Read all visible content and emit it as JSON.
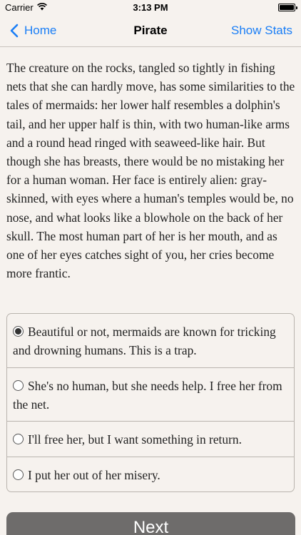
{
  "status_bar": {
    "carrier": "Carrier",
    "time": "3:13 PM",
    "wifi_icon": "wifi-icon",
    "battery_icon": "battery-icon"
  },
  "nav": {
    "back_label": "Home",
    "title": "Pirate",
    "right_label": "Show Stats",
    "accent_color": "#1a7ef6"
  },
  "story": {
    "text": "The creature on the rocks, tangled so tightly in fishing nets that she can hardly move, has some similarities to the tales of mermaids: her lower half resembles a dolphin's tail, and her upper half is thin, with two human-like arms and a round head ringed with seaweed-like hair. But though she has breasts, there would be no mistaking her for a human woman. Her face is entirely alien: gray-skinned, with eyes where a human's temples would be, no nose, and what looks like a blowhole on the back of her skull. The most human part of her is her mouth, and as one of her eyes catches sight of you, her cries become more frantic."
  },
  "choices": [
    {
      "text": "Beautiful or not, mermaids are known for tricking and drowning humans. This is a trap.",
      "selected": true
    },
    {
      "text": "She's no human, but she needs help. I free her from the net.",
      "selected": false
    },
    {
      "text": "I'll free her, but I want something in return.",
      "selected": false
    },
    {
      "text": "I put her out of her misery.",
      "selected": false
    }
  ],
  "next_button": {
    "label": "Next",
    "color": "#6e6c6b"
  }
}
